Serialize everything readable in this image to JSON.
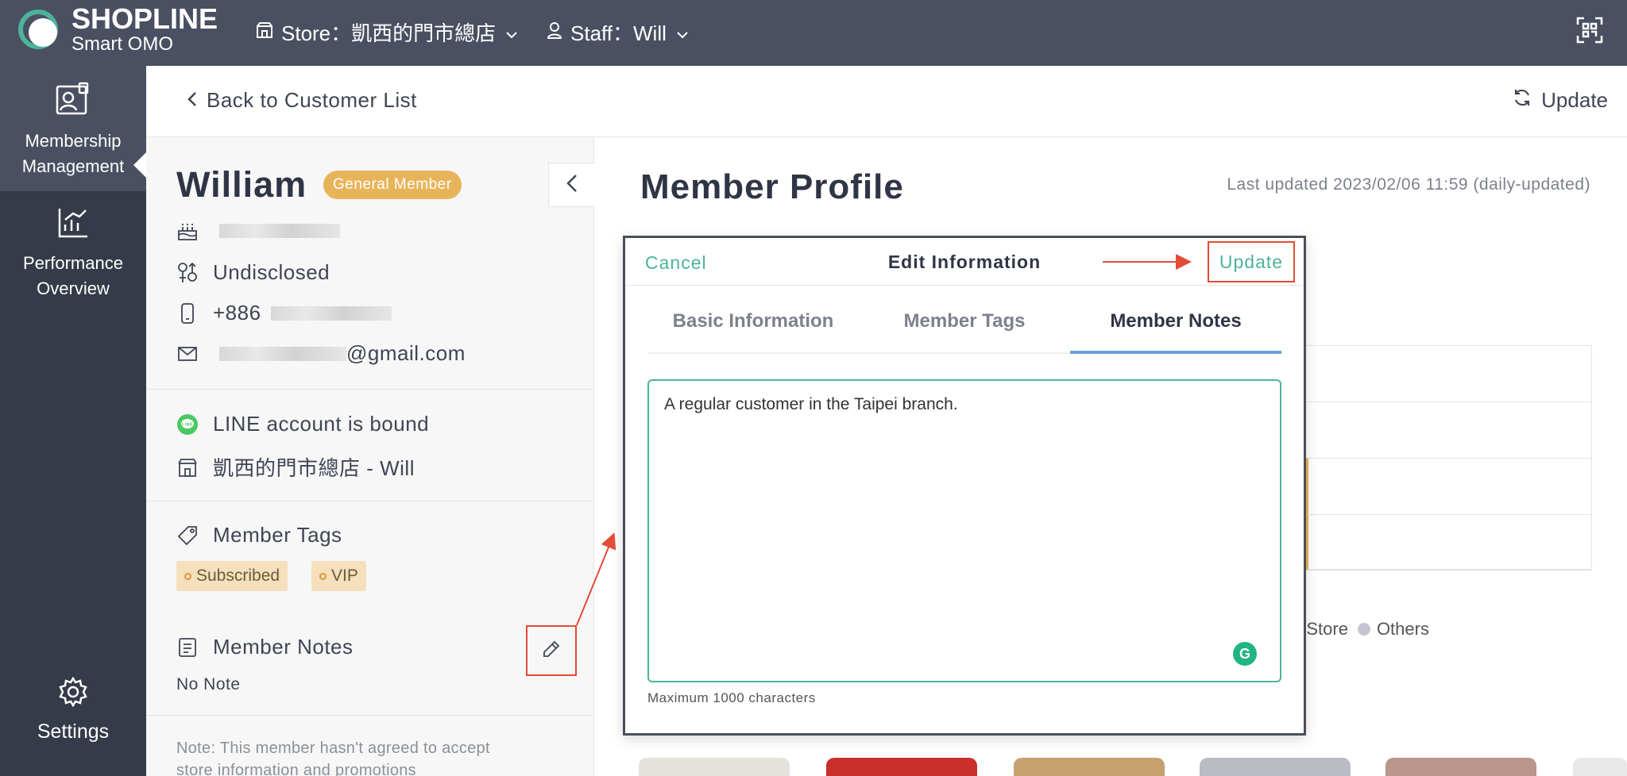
{
  "topbar": {
    "brand": "SHOPLINE",
    "brand_sub": "Smart OMO",
    "store_label": "Store：凱西的門市總店",
    "staff_label": "Staff：Will"
  },
  "sidebar": {
    "items": [
      {
        "label_line1": "Membership",
        "label_line2": "Management",
        "icon": "member-card-icon"
      },
      {
        "label_line1": "Performance",
        "label_line2": "Overview",
        "icon": "chart-icon"
      },
      {
        "label_line1": "Settings",
        "label_line2": "",
        "icon": "gear-icon"
      }
    ]
  },
  "header": {
    "back_label": "Back to Customer List",
    "update_label": "Update"
  },
  "customer": {
    "name": "William",
    "membership": "General Member",
    "gender": "Undisclosed",
    "phone_prefix": "+886",
    "email_suffix": "@gmail.com",
    "line_status": "LINE account is bound",
    "store_staff": "凱西的門市總店 - Will",
    "tags_title": "Member Tags",
    "tags": [
      "Subscribed",
      "VIP"
    ],
    "notes_title": "Member Notes",
    "notes_value": "No Note",
    "consent_note_line1": "Note: This member hasn't agreed to accept",
    "consent_note_line2": "store information and promotions"
  },
  "main": {
    "title": "Member Profile",
    "last_updated": "Last updated 2023/02/06 11:59 (daily-updated)",
    "legend_store": "e Store",
    "legend_others": "Others"
  },
  "modal": {
    "cancel_label": "Cancel",
    "title": "Edit Information",
    "update_label": "Update",
    "tabs": [
      "Basic Information",
      "Member Tags",
      "Member Notes"
    ],
    "active_tab": "Member Notes",
    "notes_text": "A regular customer in the Taipei branch.",
    "max_chars": "Maximum 1000 characters"
  },
  "colors": {
    "topbar": "#4a5061",
    "sidebar": "#353b48",
    "accent_green": "#4db39a",
    "badge_gold": "#e8b45a",
    "annotation_red": "#e24b38"
  }
}
